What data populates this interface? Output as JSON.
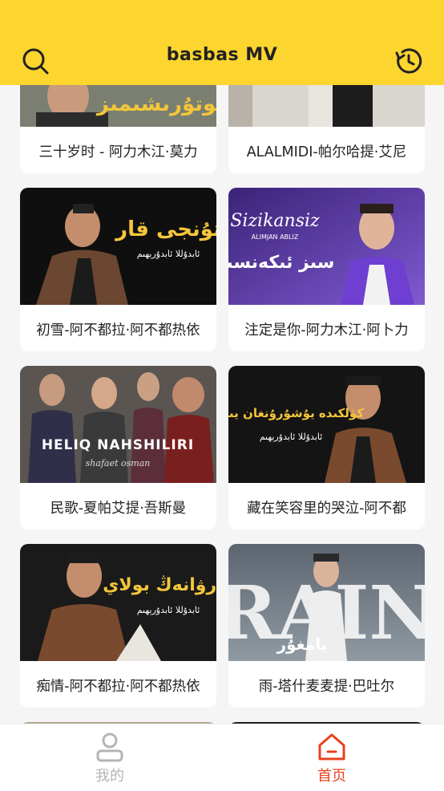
{
  "app": {
    "title": "basbas  MV"
  },
  "videos": [
    {
      "caption": "三十岁时 - 阿力木江·莫力",
      "overlay": ""
    },
    {
      "caption": "ALALMIDI-帕尔哈提·艾尼",
      "overlay": ""
    },
    {
      "caption": "初雪-阿不都拉·阿不都热依",
      "overlay": ""
    },
    {
      "caption": "注定是你-阿力木江·阿卜力",
      "overlay": "Sizikansiz",
      "overlay_sub": "ALIMJAN ABLIZ"
    },
    {
      "caption": "民歌-夏帕艾提·吾斯曼",
      "overlay": "HELIQ NAHSHILIRI",
      "overlay_sub": "shafaet osman"
    },
    {
      "caption": "藏在笑容里的哭泣-阿不都",
      "overlay": ""
    },
    {
      "caption": "痴情-阿不都拉·阿不都热依",
      "overlay": ""
    },
    {
      "caption": "雨-塔什麦麦提·巴吐尔",
      "overlay": "RAIN"
    }
  ],
  "tabs": [
    {
      "label": "我的",
      "icon": "person-icon",
      "color": "#b5b5b5",
      "active": false
    },
    {
      "label": "首页",
      "icon": "home-icon",
      "color": "#e8411e",
      "active": true
    }
  ],
  "colors": {
    "header": "#fdd52f",
    "accent": "#e8411e",
    "inactive": "#b5b5b5"
  }
}
